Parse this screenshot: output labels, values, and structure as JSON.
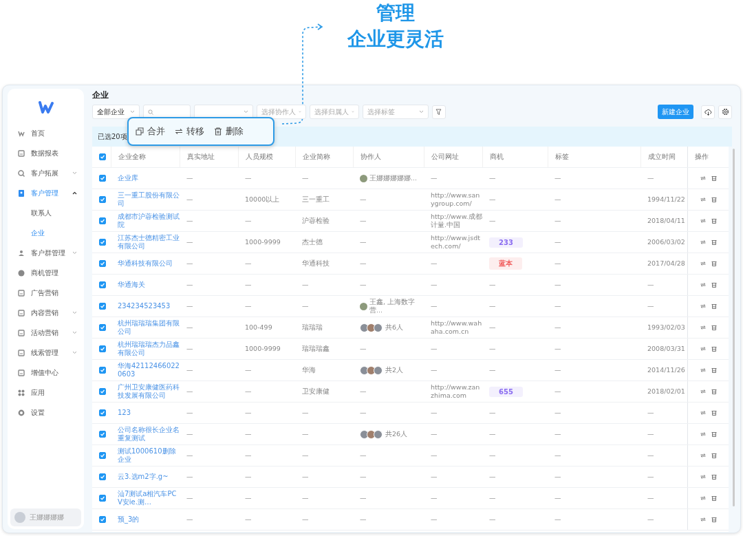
{
  "annotation": {
    "lines": [
      "管理",
      "企业更灵活"
    ]
  },
  "sidebar": {
    "items": [
      {
        "label": "首页",
        "expandable": false,
        "selected": false
      },
      {
        "label": "数据报表",
        "expandable": false,
        "selected": false
      },
      {
        "label": "客户拓展",
        "expandable": true,
        "expanded": false,
        "selected": false
      },
      {
        "label": "客户管理",
        "expandable": true,
        "expanded": true,
        "selected": true,
        "children": [
          {
            "label": "联系人",
            "selected": false
          },
          {
            "label": "企业",
            "selected": true
          }
        ]
      },
      {
        "label": "客户群管理",
        "expandable": true,
        "expanded": false,
        "selected": false
      },
      {
        "label": "商机管理",
        "expandable": false,
        "selected": false
      },
      {
        "label": "广告营销",
        "expandable": false,
        "selected": false
      },
      {
        "label": "内容营销",
        "expandable": true,
        "expanded": false,
        "selected": false
      },
      {
        "label": "活动营销",
        "expandable": true,
        "expanded": false,
        "selected": false
      },
      {
        "label": "线索管理",
        "expandable": true,
        "expanded": false,
        "selected": false
      },
      {
        "label": "增值中心",
        "expandable": false,
        "selected": false
      },
      {
        "label": "应用",
        "expandable": false,
        "selected": false
      },
      {
        "label": "设置",
        "expandable": false,
        "selected": false
      }
    ],
    "user": {
      "name": "王娜娜娜娜"
    }
  },
  "page_title": "企业",
  "filters": [
    {
      "kind": "select",
      "value": "全部企业"
    },
    {
      "kind": "search"
    },
    {
      "kind": "select"
    },
    {
      "kind": "select",
      "placeholder": "选择协作人"
    },
    {
      "kind": "select",
      "placeholder": "选择归属人"
    },
    {
      "kind": "select",
      "placeholder": "选择标签"
    }
  ],
  "new_button": "新建企业",
  "selection": "已选20项",
  "bulk_actions": [
    {
      "kind": "merge",
      "label": "合并"
    },
    {
      "kind": "transfer",
      "label": "转移"
    },
    {
      "kind": "delete",
      "label": "删除"
    }
  ],
  "table": {
    "all_checked": true,
    "columns": [
      "企业全称",
      "真实地址",
      "人员规模",
      "企业简称",
      "协作人",
      "公司网址",
      "商机",
      "标签",
      "成立时间",
      "操作"
    ],
    "rows": [
      {
        "checked": true,
        "name": "企业库",
        "address": "—",
        "scale": "—",
        "short_name": "—",
        "collaborator": {
          "kind": "single",
          "text": "王娜娜娜娜娜..."
        },
        "website": "—",
        "opportunity": {
          "kind": "text",
          "text": "—"
        },
        "label": "—",
        "founded": "—"
      },
      {
        "checked": true,
        "name": "三一重工股份有限公司",
        "address": "—",
        "scale": "10000以上",
        "short_name": "三一重工",
        "collaborator": {
          "kind": "none",
          "text": "—"
        },
        "website": "http://www.sanygroup.com/",
        "opportunity": {
          "kind": "text",
          "text": "—"
        },
        "label": "—",
        "founded": "1994/11/22"
      },
      {
        "checked": true,
        "name": "成都市沪蓉检验测试院",
        "address": "—",
        "scale": "—",
        "short_name": "沪蓉检验",
        "collaborator": {
          "kind": "none",
          "text": "—"
        },
        "website": "http://www.成都计量.中国",
        "opportunity": {
          "kind": "text",
          "text": "—"
        },
        "label": "—",
        "founded": "2018/04/11"
      },
      {
        "checked": true,
        "name": "江苏杰士德精密工业有限公司",
        "address": "—",
        "scale": "1000-9999",
        "short_name": "杰士德",
        "collaborator": {
          "kind": "none",
          "text": "—"
        },
        "website": "http://www.jsdtech.com/",
        "opportunity": {
          "kind": "tag",
          "text": "233",
          "color": "#8a6cf0"
        },
        "label": "—",
        "founded": "2006/03/02"
      },
      {
        "checked": true,
        "name": "华通科技有限公司",
        "address": "—",
        "scale": "—",
        "short_name": "华通科技",
        "collaborator": {
          "kind": "none",
          "text": "—"
        },
        "website": "—",
        "opportunity": {
          "kind": "tag",
          "text": "蓝本",
          "color": "#f05a5a"
        },
        "label": "—",
        "founded": "2017/04/28"
      },
      {
        "checked": true,
        "name": "华通海关",
        "address": "—",
        "scale": "—",
        "short_name": "—",
        "collaborator": {
          "kind": "none",
          "text": "—"
        },
        "website": "—",
        "opportunity": {
          "kind": "text",
          "text": "—"
        },
        "label": "—",
        "founded": "—"
      },
      {
        "checked": true,
        "name": "234234523453",
        "address": "—",
        "scale": "—",
        "short_name": "—",
        "collaborator": {
          "kind": "single",
          "text": "王鑫, 上海数字营..."
        },
        "website": "—",
        "opportunity": {
          "kind": "text",
          "text": "—"
        },
        "label": "—",
        "founded": "—"
      },
      {
        "checked": true,
        "name": "杭州瑞瑞瑞集团有限公司",
        "address": "—",
        "scale": "100-499",
        "short_name": "瑞瑞瑞",
        "collaborator": {
          "kind": "group",
          "text": "共6人"
        },
        "website": "http://www.wahaha.com.cn",
        "opportunity": {
          "kind": "text",
          "text": "—"
        },
        "label": "—",
        "founded": "1993/02/03"
      },
      {
        "checked": true,
        "name": "杭州瑞瑞瑞杰力品鑫有限公司",
        "address": "—",
        "scale": "1000-9999",
        "short_name": "瑞瑞瑞鑫",
        "collaborator": {
          "kind": "none",
          "text": "—"
        },
        "website": "—",
        "opportunity": {
          "kind": "text",
          "text": "—"
        },
        "label": "—",
        "founded": "2008/03/31"
      },
      {
        "checked": true,
        "name": "华海421124660220603",
        "address": "—",
        "scale": "—",
        "short_name": "华海",
        "collaborator": {
          "kind": "group",
          "text": "共2人"
        },
        "website": "—",
        "opportunity": {
          "kind": "text",
          "text": "—"
        },
        "label": "—",
        "founded": "2014/11/26"
      },
      {
        "checked": true,
        "name": "广州卫安康健医药科技发展有限公司",
        "address": "—",
        "scale": "—",
        "short_name": "卫安康健",
        "collaborator": {
          "kind": "none",
          "text": "—"
        },
        "website": "http://www.zanzhima.com",
        "opportunity": {
          "kind": "tag",
          "text": "655",
          "color": "#8a6cf0"
        },
        "label": "—",
        "founded": "2018/02/01"
      },
      {
        "checked": true,
        "name": "123",
        "address": "—",
        "scale": "—",
        "short_name": "—",
        "collaborator": {
          "kind": "none",
          "text": "—"
        },
        "website": "—",
        "opportunity": {
          "kind": "text",
          "text": "—"
        },
        "label": "—",
        "founded": "—"
      },
      {
        "checked": true,
        "name": "公司名称很长企业名重复测试",
        "address": "—",
        "scale": "—",
        "short_name": "—",
        "collaborator": {
          "kind": "group",
          "text": "共26人"
        },
        "website": "—",
        "opportunity": {
          "kind": "text",
          "text": "—"
        },
        "label": "—",
        "founded": "—"
      },
      {
        "checked": true,
        "name": "测试1000610删除企业",
        "address": "—",
        "scale": "—",
        "short_name": "—",
        "collaborator": {
          "kind": "none",
          "text": "—"
        },
        "website": "—",
        "opportunity": {
          "kind": "text",
          "text": "—"
        },
        "label": "—",
        "founded": "—"
      },
      {
        "checked": true,
        "name": "云3.选m2字.g~",
        "address": "—",
        "scale": "—",
        "short_name": "—",
        "collaborator": {
          "kind": "none",
          "text": "—"
        },
        "website": "—",
        "opportunity": {
          "kind": "text",
          "text": "—"
        },
        "label": "—",
        "founded": "—"
      },
      {
        "checked": true,
        "name": "汕7测试a相汽车PCV安ie.测…",
        "address": "—",
        "scale": "—",
        "short_name": "—",
        "collaborator": {
          "kind": "none",
          "text": "—"
        },
        "website": "—",
        "opportunity": {
          "kind": "text",
          "text": "—"
        },
        "label": "—",
        "founded": "—"
      },
      {
        "checked": true,
        "name": "预_3的",
        "address": "—",
        "scale": "—",
        "short_name": "—",
        "collaborator": {
          "kind": "none",
          "text": "—"
        },
        "website": "—",
        "opportunity": {
          "kind": "text",
          "text": "—"
        },
        "label": "—",
        "founded": "—"
      }
    ]
  }
}
